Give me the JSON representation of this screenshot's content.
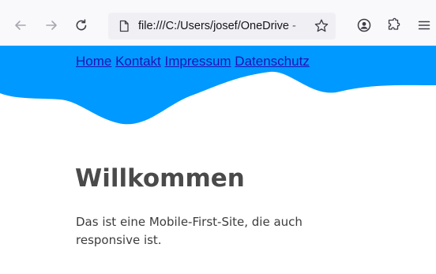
{
  "browser": {
    "url": "file:///C:/Users/josef/OneDrive - ",
    "icons": {
      "back": "back-arrow-icon",
      "forward": "forward-arrow-icon",
      "reload": "reload-icon",
      "page": "page-icon",
      "bookmark": "bookmark-star-icon",
      "account": "account-icon",
      "extensions": "extensions-icon",
      "menu": "hamburger-menu-icon"
    }
  },
  "nav": {
    "items": [
      "Home",
      "Kontakt",
      "Impressum",
      "Datenschutz"
    ]
  },
  "main": {
    "heading": "Willkommen",
    "text": "Das ist eine Mobile-First-Site, die auch responsive ist."
  },
  "colors": {
    "header_wave": "#0099ff",
    "link": "#2111b8",
    "heading": "#4a4a4a",
    "body_text": "#3d3d3d"
  }
}
